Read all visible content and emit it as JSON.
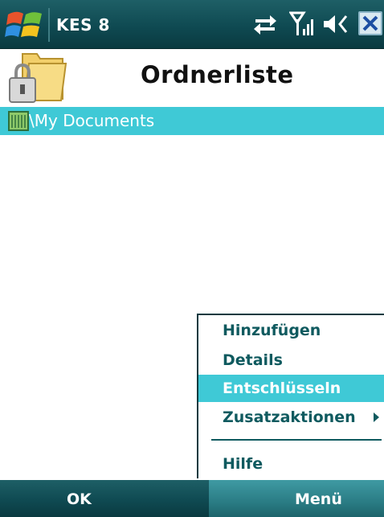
{
  "titlebar": {
    "app_title": "KES 8",
    "icons": [
      "windows-start-icon",
      "connectivity-icon",
      "signal-icon",
      "volume-icon",
      "close-icon"
    ]
  },
  "header": {
    "title": "Ordnerliste",
    "icon": "encrypted-folder-icon"
  },
  "folder_list": {
    "items": [
      {
        "label": "\\My Documents",
        "icon": "folder-icon"
      }
    ]
  },
  "menu": {
    "items": [
      {
        "label": "Hinzufügen"
      },
      {
        "label": "Details"
      },
      {
        "label": "Entschlüsseln",
        "selected": true
      },
      {
        "label": "Zusatzaktionen",
        "has_submenu": true
      },
      {
        "label": "Hilfe"
      }
    ]
  },
  "softkeys": {
    "left": "OK",
    "right": "Menü"
  },
  "colors": {
    "accent": "#3fc9d6",
    "bar": "#0f4a52",
    "menu_text": "#0f5a5f"
  }
}
